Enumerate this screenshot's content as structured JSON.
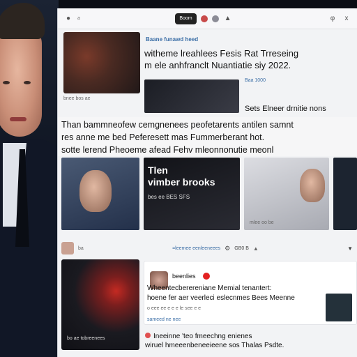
{
  "topbar": {
    "title": "a",
    "pill": "Boom",
    "right_icon": "φ",
    "close_icon": "x"
  },
  "featured": {
    "source": "Baane funawd heed",
    "headline": "witheme lreahlees Fesis Rat Trreseing\nm ele anhfranclt Nuantiatie siy 2022.",
    "thumb_caption": "bnee bos ae",
    "side_label": "Baa 1000",
    "side_text": "Sets Elneer drnitie nons"
  },
  "paragraph": {
    "lines": [
      "Than bammneofew  cemgnenees peofetarents antilen samnt",
      "res anne me bed Peferesett mas Fummerberant hot.",
      "sotte lerend Pheoeme afead Fehv mleonnonutie meonl"
    ]
  },
  "cards": {
    "c2_title": "Tlen\nvimber brooks",
    "c2_sub": "bes ee BES SFS",
    "c3_cap": "mlee oo be"
  },
  "bar2": {
    "label": "ba",
    "center": "=leemee eenleeneees",
    "right": "GB0 B"
  },
  "left_card": {
    "caption": "bo ae tobreenees"
  },
  "post": {
    "name": "beenlies",
    "body": "Wheentecberereniane Memial tenantert:\nhoene fer aer veerleci eslecnmes Bees Meenne",
    "meta": "o   eee ee e e  e le  see e e",
    "date": "sameed ne nee"
  },
  "footer": {
    "line1": "Ineeinne 'teo fmeechng enienes",
    "line2": "wiruel hmeeenbeneeieene sos Thalas Psdte."
  }
}
